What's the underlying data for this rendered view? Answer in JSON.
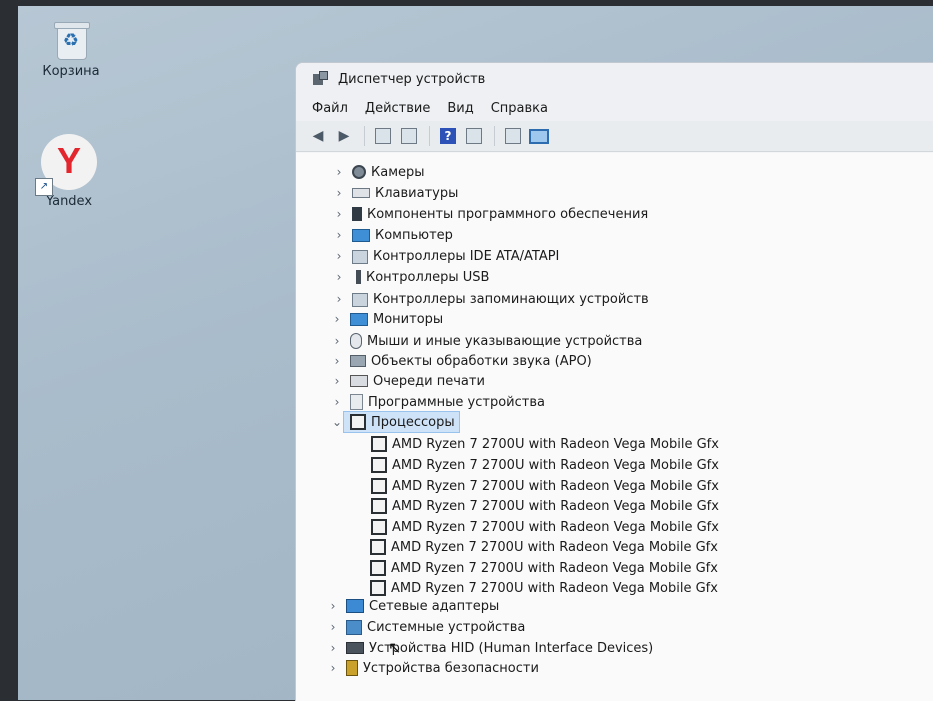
{
  "desktop": {
    "icons": [
      {
        "label": "Корзина",
        "icon": "recycle-bin-icon"
      },
      {
        "label": "Yandex",
        "icon": "yandex-browser-icon"
      }
    ]
  },
  "window": {
    "title": "Диспетчер устройств",
    "menu": [
      "Файл",
      "Действие",
      "Вид",
      "Справка"
    ],
    "toolbar": [
      "back-arrow-icon",
      "forward-arrow-icon",
      "properties-icon",
      "update-driver-icon",
      "help-icon",
      "view-icon",
      "scan-hardware-icon",
      "monitor-icon"
    ]
  },
  "tree": {
    "top": [
      {
        "label": "Камеры"
      },
      {
        "label": "Клавиатуры"
      },
      {
        "label": "Компоненты программного обеспечения"
      },
      {
        "label": "Компьютер"
      },
      {
        "label": "Контроллеры IDE ATA/ATAPI"
      },
      {
        "label": "Контроллеры USB"
      },
      {
        "label": "Контроллеры запоминающих устройств"
      },
      {
        "label": "Мониторы"
      },
      {
        "label": "Мыши и иные указывающие устройства"
      },
      {
        "label": "Объекты обработки звука (APO)"
      },
      {
        "label": "Очереди печати"
      },
      {
        "label": "Программные устройства"
      }
    ],
    "expanded": {
      "label": "Процессоры"
    },
    "processors": [
      "AMD Ryzen 7 2700U with Radeon Vega Mobile Gfx",
      "AMD Ryzen 7 2700U with Radeon Vega Mobile Gfx",
      "AMD Ryzen 7 2700U with Radeon Vega Mobile Gfx",
      "AMD Ryzen 7 2700U with Radeon Vega Mobile Gfx",
      "AMD Ryzen 7 2700U with Radeon Vega Mobile Gfx",
      "AMD Ryzen 7 2700U with Radeon Vega Mobile Gfx",
      "AMD Ryzen 7 2700U with Radeon Vega Mobile Gfx",
      "AMD Ryzen 7 2700U with Radeon Vega Mobile Gfx"
    ],
    "bottom": [
      {
        "label": "Сетевые адаптеры"
      },
      {
        "label": "Системные устройства"
      },
      {
        "label": "Устройства HID (Human Interface Devices)"
      },
      {
        "label": "Устройства безопасности"
      }
    ]
  }
}
